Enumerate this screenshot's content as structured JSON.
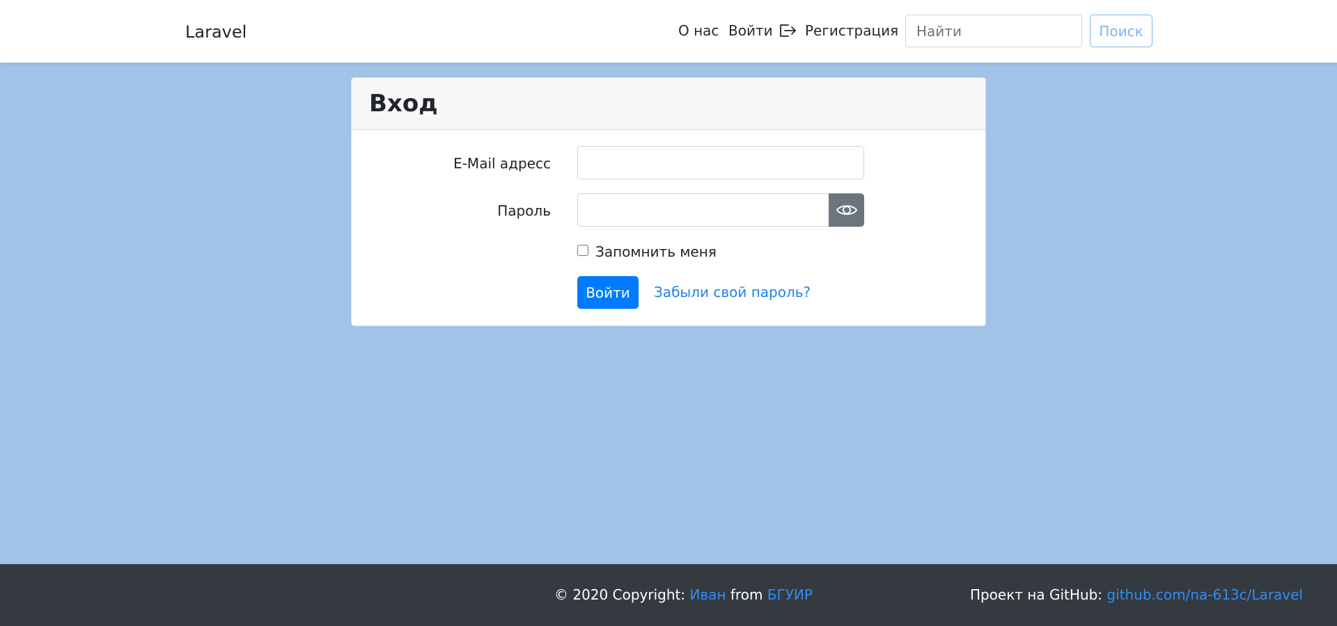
{
  "navbar": {
    "brand": "Laravel",
    "links": {
      "about": "О нас",
      "login": "Войти",
      "register": "Регистрация"
    },
    "search": {
      "placeholder": "Найти",
      "value": "",
      "button_label": "Поиск"
    }
  },
  "login_card": {
    "title": "Вход",
    "email": {
      "label": "E-Mail адресс",
      "value": ""
    },
    "password": {
      "label": "Пароль",
      "value": ""
    },
    "remember": {
      "label": "Запомнить меня",
      "checked": false
    },
    "submit_label": "Войти",
    "forgot_link": "Забыли свой пароль?"
  },
  "footer": {
    "copyright_prefix": "© 2020 Copyright: ",
    "author": "Иван",
    "from_word": " from ",
    "organization": "БГУИР",
    "github_label": "Проект на GitHub: ",
    "github_link": "github.com/na-613c/Laravel"
  },
  "icons": {
    "login": "sign-in-icon",
    "password_toggle": "eye-icon"
  },
  "colors": {
    "page_background": "#a0c3e7",
    "primary": "#007bff",
    "secondary": "#6c757d",
    "footer_background": "#343a40",
    "link": "#1e83f0"
  }
}
